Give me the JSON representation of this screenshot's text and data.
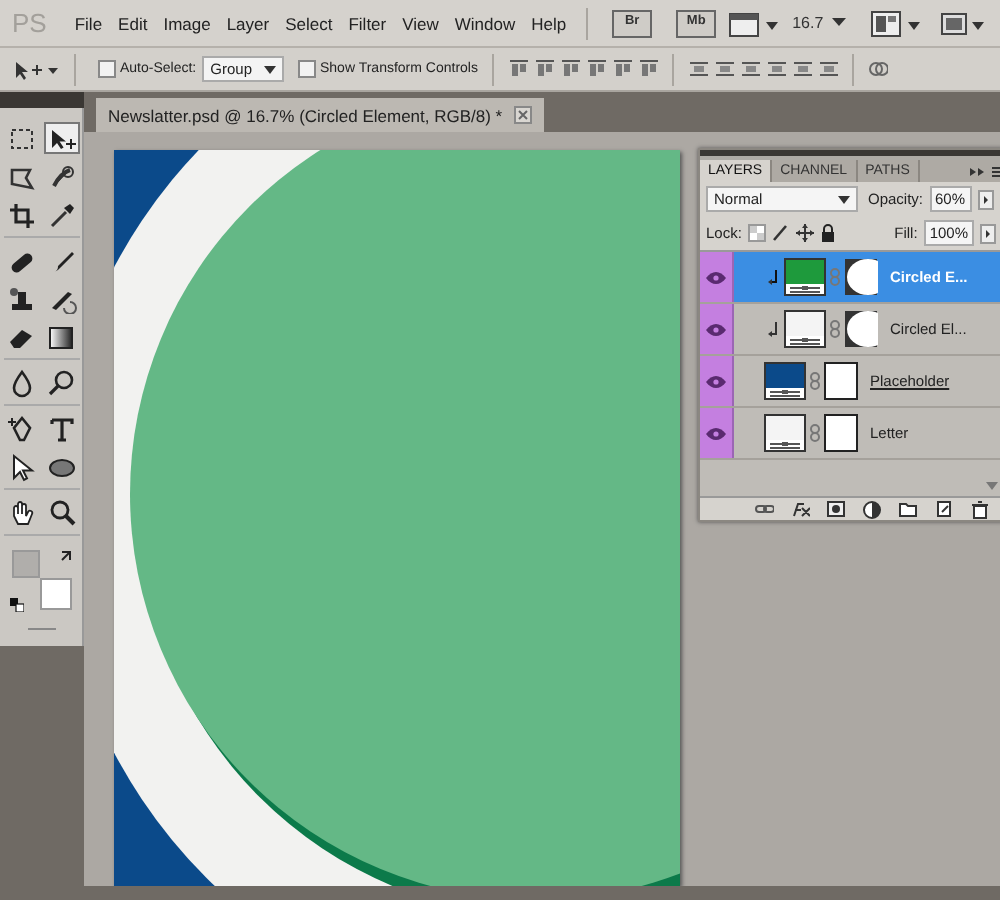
{
  "app_logo": "PS",
  "menu": [
    "File",
    "Edit",
    "Image",
    "Layer",
    "Select",
    "Filter",
    "View",
    "Window",
    "Help"
  ],
  "app_bar": {
    "bridge": "Br",
    "mini_bridge": "Mb",
    "zoom": "16.7"
  },
  "options_bar": {
    "auto_select": {
      "label": "Auto-Select:",
      "checked": false
    },
    "auto_select_target": "Group",
    "transform_controls": {
      "label": "Show Transform Controls",
      "checked": false
    }
  },
  "tools": [
    {
      "kind": "marquee",
      "selected": false
    },
    {
      "kind": "move",
      "selected": true
    },
    {
      "kind": "lasso",
      "selected": false
    },
    {
      "kind": "quick-select",
      "selected": false
    },
    {
      "kind": "crop",
      "selected": false
    },
    {
      "kind": "eyedropper",
      "selected": false
    },
    {
      "kind": "healing",
      "selected": false
    },
    {
      "kind": "brush",
      "selected": false
    },
    {
      "kind": "stamp",
      "selected": false
    },
    {
      "kind": "history-brush",
      "selected": false
    },
    {
      "kind": "eraser",
      "selected": false
    },
    {
      "kind": "gradient",
      "selected": false
    },
    {
      "kind": "blur",
      "selected": false
    },
    {
      "kind": "dodge",
      "selected": false
    },
    {
      "kind": "pen",
      "selected": false
    },
    {
      "kind": "type",
      "selected": false
    },
    {
      "kind": "path-select",
      "selected": false
    },
    {
      "kind": "ellipse",
      "selected": false
    },
    {
      "kind": "hand",
      "selected": false
    },
    {
      "kind": "zoom",
      "selected": false
    }
  ],
  "document_tab": {
    "title": "Newslatter.psd @ 16.7% (Circled Element, RGB/8) *"
  },
  "layers_panel": {
    "tabs": [
      {
        "label": "LAYERS",
        "selected": true
      },
      {
        "label": "CHANNEL",
        "selected": false
      },
      {
        "label": "PATHS",
        "selected": false
      }
    ],
    "blend_mode": "Normal",
    "opacity_label": "Opacity:",
    "opacity": "60%",
    "lock_label": "Lock:",
    "fill_label": "Fill:",
    "fill": "100%",
    "layers": [
      {
        "name": "Circled E...",
        "selected": true,
        "visible": true,
        "clipped": true,
        "underlined": false,
        "color": "#1e9a3c",
        "kind": "circle-mask"
      },
      {
        "name": "Circled El...",
        "selected": false,
        "visible": true,
        "clipped": true,
        "underlined": false,
        "color": "#f4f4f4",
        "kind": "circle-mask"
      },
      {
        "name": "Placeholder",
        "selected": false,
        "visible": true,
        "clipped": false,
        "underlined": true,
        "color": "#0b4a8a",
        "kind": "plain-mask"
      },
      {
        "name": "Letter",
        "selected": false,
        "visible": true,
        "clipped": false,
        "underlined": false,
        "color": "#f4f4f4",
        "kind": "plain-mask"
      }
    ]
  }
}
